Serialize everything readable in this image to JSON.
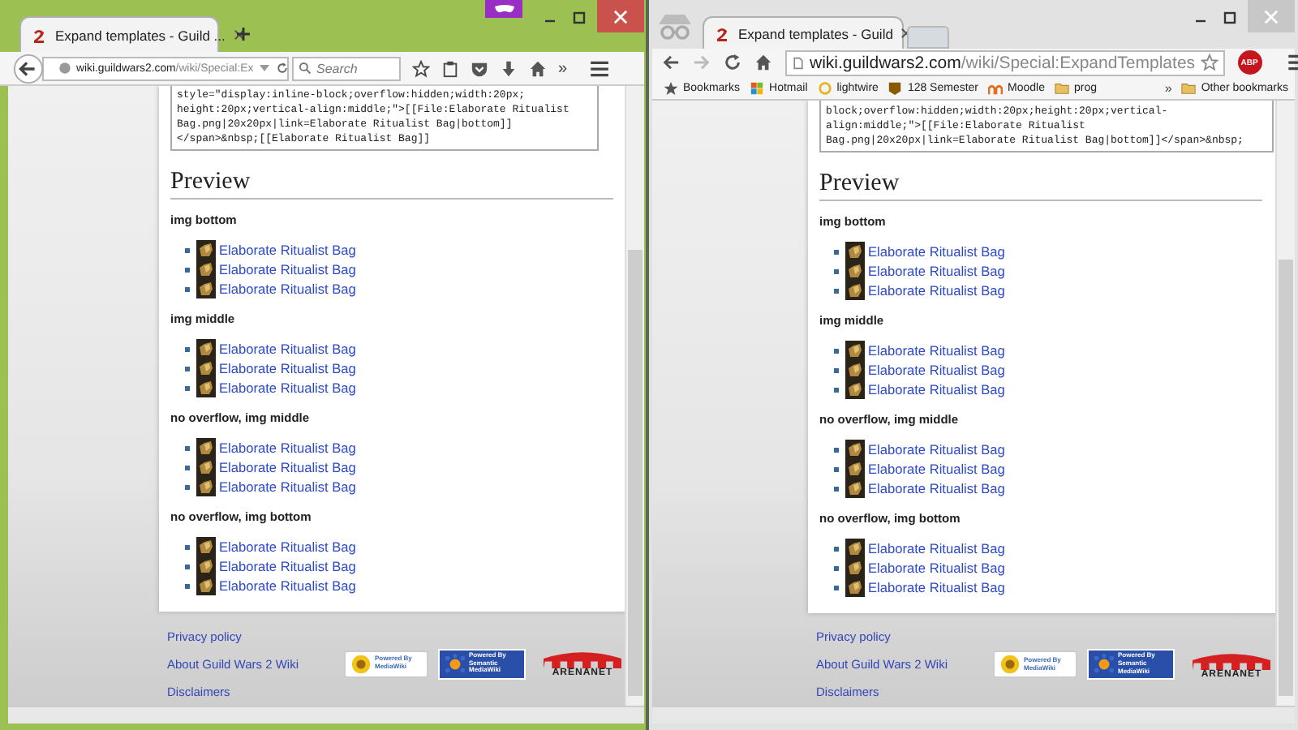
{
  "windows": [
    {
      "kind": "firefox",
      "tab": {
        "title": "Expand templates - Guild ..."
      },
      "address": {
        "host": "wiki.guildwars2.com",
        "path": "/wiki/Special:Ex"
      },
      "search": {
        "placeholder": "Search"
      },
      "overflow": "»",
      "source_lines": [
        "style=\"display:inline-block;overflow:hidden;width:20px;",
        "height:20px;vertical-align:middle;\">[[File:Elaborate Ritualist",
        "Bag.png|20x20px|link=Elaborate Ritualist Bag|bottom]]",
        "</span>&nbsp;[[Elaborate Ritualist Bag]]"
      ],
      "preview": {
        "heading": "Preview",
        "sections": [
          {
            "heading": "img bottom",
            "items": [
              "Elaborate Ritualist Bag",
              "Elaborate Ritualist Bag",
              "Elaborate Ritualist Bag"
            ]
          },
          {
            "heading": "img middle",
            "items": [
              "Elaborate Ritualist Bag",
              "Elaborate Ritualist Bag",
              "Elaborate Ritualist Bag"
            ]
          },
          {
            "heading": "no overflow, img middle",
            "items": [
              "Elaborate Ritualist Bag",
              "Elaborate Ritualist Bag",
              "Elaborate Ritualist Bag"
            ]
          },
          {
            "heading": "no overflow, img bottom",
            "items": [
              "Elaborate Ritualist Bag",
              "Elaborate Ritualist Bag",
              "Elaborate Ritualist Bag"
            ]
          }
        ]
      },
      "footer_links": [
        "Privacy policy",
        "About Guild Wars 2 Wiki",
        "Disclaimers"
      ],
      "badges": [
        {
          "kind": "mediawiki",
          "lines": [
            "Powered By",
            "MediaWiki"
          ]
        },
        {
          "kind": "smw",
          "lines": [
            "Powered By",
            "Semantic",
            "MediaWiki"
          ]
        },
        {
          "kind": "arenanet",
          "lines": [
            "ARENANET"
          ]
        }
      ]
    },
    {
      "kind": "chrome",
      "tab": {
        "title": "Expand templates - Guild"
      },
      "address": {
        "host": "wiki.guildwars2.com",
        "path": "/wiki/Special:ExpandTemplates"
      },
      "extension": "ABP",
      "bookmarks": [
        {
          "label": "Bookmarks",
          "kind": "star"
        },
        {
          "label": "Hotmail",
          "kind": "windows"
        },
        {
          "label": "lightwire",
          "kind": "sun"
        },
        {
          "label": "128 Semester",
          "kind": "badge"
        },
        {
          "label": "Moodle",
          "kind": "hat"
        },
        {
          "label": "prog",
          "kind": "folder"
        }
      ],
      "bookmarks_overflow": "»",
      "other_bookmarks": "Other bookmarks",
      "source_lines": [
        "block;overflow:hidden;width:20px;height:20px;vertical-",
        "align:middle;\">[[File:Elaborate Ritualist",
        "Bag.png|20x20px|link=Elaborate Ritualist Bag|bottom]]</span>&nbsp;"
      ],
      "preview": {
        "heading": "Preview",
        "sections": [
          {
            "heading": "img bottom",
            "items": [
              "Elaborate Ritualist Bag",
              "Elaborate Ritualist Bag",
              "Elaborate Ritualist Bag"
            ]
          },
          {
            "heading": "img middle",
            "items": [
              "Elaborate Ritualist Bag",
              "Elaborate Ritualist Bag",
              "Elaborate Ritualist Bag"
            ]
          },
          {
            "heading": "no overflow, img middle",
            "items": [
              "Elaborate Ritualist Bag",
              "Elaborate Ritualist Bag",
              "Elaborate Ritualist Bag"
            ]
          },
          {
            "heading": "no overflow, img bottom",
            "items": [
              "Elaborate Ritualist Bag",
              "Elaborate Ritualist Bag",
              "Elaborate Ritualist Bag"
            ]
          }
        ]
      },
      "footer_links": [
        "Privacy policy",
        "About Guild Wars 2 Wiki",
        "Disclaimers"
      ],
      "badges": [
        {
          "kind": "mediawiki",
          "lines": [
            "Powered By",
            "MediaWiki"
          ]
        },
        {
          "kind": "smw",
          "lines": [
            "Powered By",
            "Semantic",
            "MediaWiki"
          ]
        },
        {
          "kind": "arenanet",
          "lines": [
            "ARENANET"
          ]
        }
      ]
    }
  ]
}
